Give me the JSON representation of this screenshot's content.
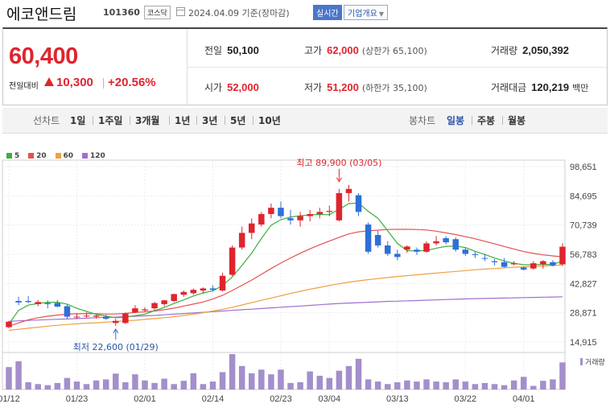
{
  "header": {
    "name": "에코앤드림",
    "code": "101360",
    "market": "코스닥",
    "date": "2024.04.09 기준(장마감)",
    "realtime": "실시간",
    "company_info": "기업개요"
  },
  "quote": {
    "price": "60,400",
    "change_label": "전일대비",
    "change": "10,300",
    "change_pct": "+20.56%",
    "prev": {
      "label": "전일",
      "value": "50,100"
    },
    "open": {
      "label": "시가",
      "value": "52,000"
    },
    "high": {
      "label": "고가",
      "value": "62,000",
      "limit": "(상한가 65,100)"
    },
    "low": {
      "label": "저가",
      "value": "51,200",
      "limit": "(하한가 35,100)"
    },
    "volume": {
      "label": "거래량",
      "value": "2,050,392"
    },
    "amount": {
      "label": "거래대금",
      "value": "120,219",
      "unit": "백만"
    }
  },
  "period_tabs": {
    "line_label": "선차트",
    "line_items": [
      "1일",
      "1주일",
      "3개월",
      "1년",
      "3년",
      "5년",
      "10년"
    ],
    "candle_label": "봉차트",
    "candle_items": [
      "일봉",
      "주봉",
      "월봉"
    ],
    "candle_selected": "일봉"
  },
  "colors": {
    "up": "#e0242e",
    "down": "#2f6fd8",
    "ma5": "#3fae3f",
    "ma20": "#e2524f",
    "ma60": "#f0a040",
    "ma120": "#a070d0",
    "volume": "#a38fcb"
  },
  "chart_data": {
    "type": "candlestick",
    "legend": [
      {
        "name": "5",
        "color": "#3fae3f"
      },
      {
        "name": "20",
        "color": "#e2524f"
      },
      {
        "name": "60",
        "color": "#f0a040"
      },
      {
        "name": "120",
        "color": "#a070d0"
      }
    ],
    "y_ticks": [
      "98,651",
      "84,695",
      "70,739",
      "56,783",
      "42,827",
      "28,871",
      "14,915"
    ],
    "ylim": [
      14915,
      98651
    ],
    "x_ticks": [
      {
        "label": "01/12",
        "index": 0
      },
      {
        "label": "01/23",
        "index": 7
      },
      {
        "label": "02/01",
        "index": 14
      },
      {
        "label": "02/14",
        "index": 21
      },
      {
        "label": "02/23",
        "index": 28
      },
      {
        "label": "03/04",
        "index": 33
      },
      {
        "label": "03/13",
        "index": 40
      },
      {
        "label": "03/22",
        "index": 47
      },
      {
        "label": "04/01",
        "index": 53
      }
    ],
    "annotations": {
      "high": {
        "text": "최고 89,900 (03/05)",
        "index": 34,
        "value": 89900
      },
      "low": {
        "text": "최저 22,600 (01/29)",
        "index": 11,
        "value": 22600
      }
    },
    "volume_label": "거래량",
    "candles": [
      {
        "o": 22000,
        "h": 25000,
        "l": 21500,
        "c": 24600
      },
      {
        "o": 34500,
        "h": 36500,
        "l": 32500,
        "c": 33800
      },
      {
        "o": 34500,
        "h": 36800,
        "l": 33500,
        "c": 34000
      },
      {
        "o": 33000,
        "h": 35000,
        "l": 32000,
        "c": 34000
      },
      {
        "o": 33500,
        "h": 34800,
        "l": 31000,
        "c": 33000
      },
      {
        "o": 33500,
        "h": 35000,
        "l": 31500,
        "c": 31800
      },
      {
        "o": 32000,
        "h": 32800,
        "l": 26000,
        "c": 27000
      },
      {
        "o": 27000,
        "h": 28500,
        "l": 26000,
        "c": 27000
      },
      {
        "o": 27500,
        "h": 29000,
        "l": 26500,
        "c": 27500
      },
      {
        "o": 27000,
        "h": 28000,
        "l": 26000,
        "c": 27500
      },
      {
        "o": 27000,
        "h": 28000,
        "l": 25500,
        "c": 26000
      },
      {
        "o": 24000,
        "h": 26000,
        "l": 22600,
        "c": 25000
      },
      {
        "o": 24000,
        "h": 29000,
        "l": 23500,
        "c": 28500
      },
      {
        "o": 29000,
        "h": 32500,
        "l": 28800,
        "c": 31000
      },
      {
        "o": 30000,
        "h": 31500,
        "l": 29500,
        "c": 30500
      },
      {
        "o": 31000,
        "h": 34000,
        "l": 30000,
        "c": 33500
      },
      {
        "o": 33000,
        "h": 35000,
        "l": 32000,
        "c": 34800
      },
      {
        "o": 34500,
        "h": 38000,
        "l": 34000,
        "c": 37800
      },
      {
        "o": 37500,
        "h": 39500,
        "l": 36500,
        "c": 38800
      },
      {
        "o": 38200,
        "h": 40500,
        "l": 37500,
        "c": 39800
      },
      {
        "o": 39500,
        "h": 41000,
        "l": 38000,
        "c": 40500
      },
      {
        "o": 40500,
        "h": 42000,
        "l": 39000,
        "c": 39800
      },
      {
        "o": 39500,
        "h": 48000,
        "l": 39000,
        "c": 46500
      },
      {
        "o": 47000,
        "h": 61000,
        "l": 46500,
        "c": 60000
      },
      {
        "o": 60000,
        "h": 70000,
        "l": 59000,
        "c": 67000
      },
      {
        "o": 67000,
        "h": 74000,
        "l": 64000,
        "c": 71500
      },
      {
        "o": 71000,
        "h": 77000,
        "l": 70000,
        "c": 76000
      },
      {
        "o": 76000,
        "h": 81000,
        "l": 74000,
        "c": 79000
      },
      {
        "o": 79000,
        "h": 82000,
        "l": 74000,
        "c": 75000
      },
      {
        "o": 74000,
        "h": 78000,
        "l": 71000,
        "c": 73000
      },
      {
        "o": 73000,
        "h": 77000,
        "l": 70000,
        "c": 75000
      },
      {
        "o": 75000,
        "h": 78000,
        "l": 72500,
        "c": 76000
      },
      {
        "o": 76000,
        "h": 79000,
        "l": 74000,
        "c": 77000
      },
      {
        "o": 77000,
        "h": 80000,
        "l": 75000,
        "c": 77500
      },
      {
        "o": 73000,
        "h": 88000,
        "l": 72500,
        "c": 86000
      },
      {
        "o": 86000,
        "h": 89900,
        "l": 82000,
        "c": 88000
      },
      {
        "o": 85000,
        "h": 86000,
        "l": 75000,
        "c": 77000
      },
      {
        "o": 71000,
        "h": 72000,
        "l": 57000,
        "c": 58000
      },
      {
        "o": 66000,
        "h": 68000,
        "l": 60000,
        "c": 61000
      },
      {
        "o": 61000,
        "h": 63000,
        "l": 56000,
        "c": 57000
      },
      {
        "o": 57000,
        "h": 59000,
        "l": 54000,
        "c": 55500
      },
      {
        "o": 59000,
        "h": 61000,
        "l": 57500,
        "c": 60500
      },
      {
        "o": 59000,
        "h": 60000,
        "l": 56500,
        "c": 58000
      },
      {
        "o": 58000,
        "h": 63000,
        "l": 57500,
        "c": 62000
      },
      {
        "o": 62000,
        "h": 65500,
        "l": 61000,
        "c": 63000
      },
      {
        "o": 64500,
        "h": 65500,
        "l": 61500,
        "c": 62500
      },
      {
        "o": 64000,
        "h": 65000,
        "l": 58000,
        "c": 59000
      },
      {
        "o": 59000,
        "h": 60000,
        "l": 56000,
        "c": 57000
      },
      {
        "o": 56800,
        "h": 58000,
        "l": 55000,
        "c": 56500
      },
      {
        "o": 55000,
        "h": 57000,
        "l": 53500,
        "c": 54800
      },
      {
        "o": 53500,
        "h": 54500,
        "l": 51500,
        "c": 53000
      },
      {
        "o": 53000,
        "h": 55000,
        "l": 50500,
        "c": 50800
      },
      {
        "o": 52000,
        "h": 53500,
        "l": 51500,
        "c": 52500
      },
      {
        "o": 50500,
        "h": 51000,
        "l": 49000,
        "c": 49500
      },
      {
        "o": 50000,
        "h": 53500,
        "l": 49500,
        "c": 52500
      },
      {
        "o": 52000,
        "h": 54000,
        "l": 50000,
        "c": 53500
      },
      {
        "o": 53000,
        "h": 54000,
        "l": 51000,
        "c": 51500
      },
      {
        "o": 52000,
        "h": 62000,
        "l": 51200,
        "c": 60400
      }
    ],
    "volumes": [
      62,
      78,
      20,
      15,
      12,
      18,
      32,
      22,
      15,
      25,
      28,
      44,
      20,
      42,
      25,
      18,
      30,
      15,
      24,
      45,
      15,
      22,
      48,
      98,
      65,
      45,
      55,
      42,
      55,
      18,
      20,
      50,
      38,
      32,
      52,
      65,
      85,
      28,
      22,
      15,
      20,
      25,
      22,
      28,
      22,
      20,
      28,
      22,
      15,
      18,
      15,
      12,
      25,
      35,
      10,
      24,
      28,
      75
    ],
    "ma5": [
      23500,
      30000,
      32500,
      33300,
      33900,
      33900,
      33000,
      31000,
      29500,
      28100,
      27300,
      26500,
      26800,
      27500,
      28200,
      29900,
      31400,
      33300,
      35000,
      36900,
      38300,
      39400,
      41800,
      46000,
      51500,
      57400,
      64300,
      70700,
      73300,
      74600,
      75200,
      75600,
      75800,
      75700,
      78300,
      81000,
      81200,
      77300,
      74000,
      68000,
      62000,
      58500,
      58400,
      58600,
      59700,
      60600,
      60700,
      60000,
      58200,
      56700,
      55000,
      53600,
      52500,
      51800,
      51800,
      52000,
      51900,
      53600
    ],
    "ma20": [
      22500,
      24000,
      25500,
      26500,
      27200,
      27800,
      28200,
      28400,
      28500,
      28400,
      28300,
      28300,
      28600,
      29000,
      29300,
      29700,
      30300,
      31100,
      32100,
      33000,
      34000,
      35500,
      37200,
      39500,
      42000,
      44500,
      47200,
      50000,
      52600,
      55000,
      57300,
      59400,
      61300,
      63100,
      64900,
      66500,
      67500,
      68000,
      68300,
      68600,
      68700,
      68700,
      68600,
      68400,
      67800,
      67000,
      66200,
      65200,
      64200,
      63000,
      61800,
      60500,
      59300,
      58100,
      57200,
      56500,
      56000,
      55600
    ],
    "ma60": [
      20500,
      21000,
      21500,
      22000,
      22500,
      22900,
      23300,
      23600,
      23900,
      24100,
      24400,
      24700,
      25000,
      25300,
      25700,
      26100,
      26500,
      27000,
      27600,
      28200,
      28900,
      29700,
      30500,
      31500,
      32600,
      33700,
      34800,
      35900,
      37000,
      38100,
      39100,
      40100,
      41000,
      41900,
      42700,
      43500,
      44100,
      44700,
      45200,
      45700,
      46200,
      46600,
      47000,
      47400,
      47800,
      48200,
      48600,
      49000,
      49400,
      49700,
      50000,
      50300,
      50600,
      50800,
      51000,
      51200,
      51400,
      51700
    ],
    "ma120": [
      24800,
      25000,
      25200,
      25400,
      25600,
      25800,
      25900,
      26100,
      26300,
      26500,
      26700,
      26800,
      27000,
      27200,
      27400,
      27600,
      27900,
      28200,
      28500,
      28800,
      29100,
      29400,
      29700,
      30000,
      30300,
      30600,
      30900,
      31200,
      31500,
      31800,
      32100,
      32400,
      32700,
      33000,
      33300,
      33500,
      33700,
      33900,
      34100,
      34300,
      34400,
      34600,
      34700,
      34900,
      35000,
      35200,
      35300,
      35500,
      35600,
      35700,
      35800,
      35900,
      36000,
      36100,
      36200,
      36300,
      36400,
      36500
    ]
  }
}
